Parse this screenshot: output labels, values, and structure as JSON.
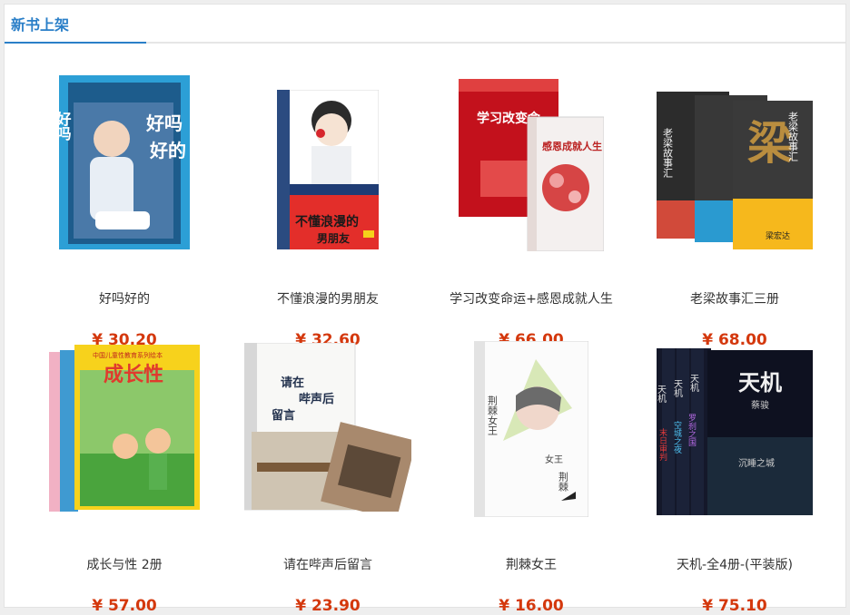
{
  "section": {
    "title": "新书上架"
  },
  "colors": {
    "accent": "#2a7fc8",
    "price": "#d4380d"
  },
  "books": [
    {
      "title": "好吗好的",
      "price": "¥ 30.20",
      "cover_text": "好吗好的"
    },
    {
      "title": "不懂浪漫的男朋友",
      "price": "¥ 32.60",
      "cover_text": "不懂浪漫的男朋友"
    },
    {
      "title": "学习改变命运+感恩成就人生",
      "price": "¥ 66.00",
      "cover_text": "学习改变命运",
      "cover_text2": "感恩成就人生"
    },
    {
      "title": "老梁故事汇三册",
      "price": "¥ 68.00",
      "cover_text": "老梁故事汇",
      "cover_text2": "梁"
    },
    {
      "title": "成长与性 2册",
      "price": "¥ 57.00",
      "cover_text": "成长与性"
    },
    {
      "title": "请在哔声后留言",
      "price": "¥ 23.90",
      "cover_text": "请在哔声后留言"
    },
    {
      "title": "荆棘女王",
      "price": "¥ 16.00",
      "cover_text": "荆棘女王"
    },
    {
      "title": "天机-全4册-(平装版)",
      "price": "¥ 75.10",
      "cover_text": "天机",
      "cover_text2": "蔡骏"
    }
  ]
}
